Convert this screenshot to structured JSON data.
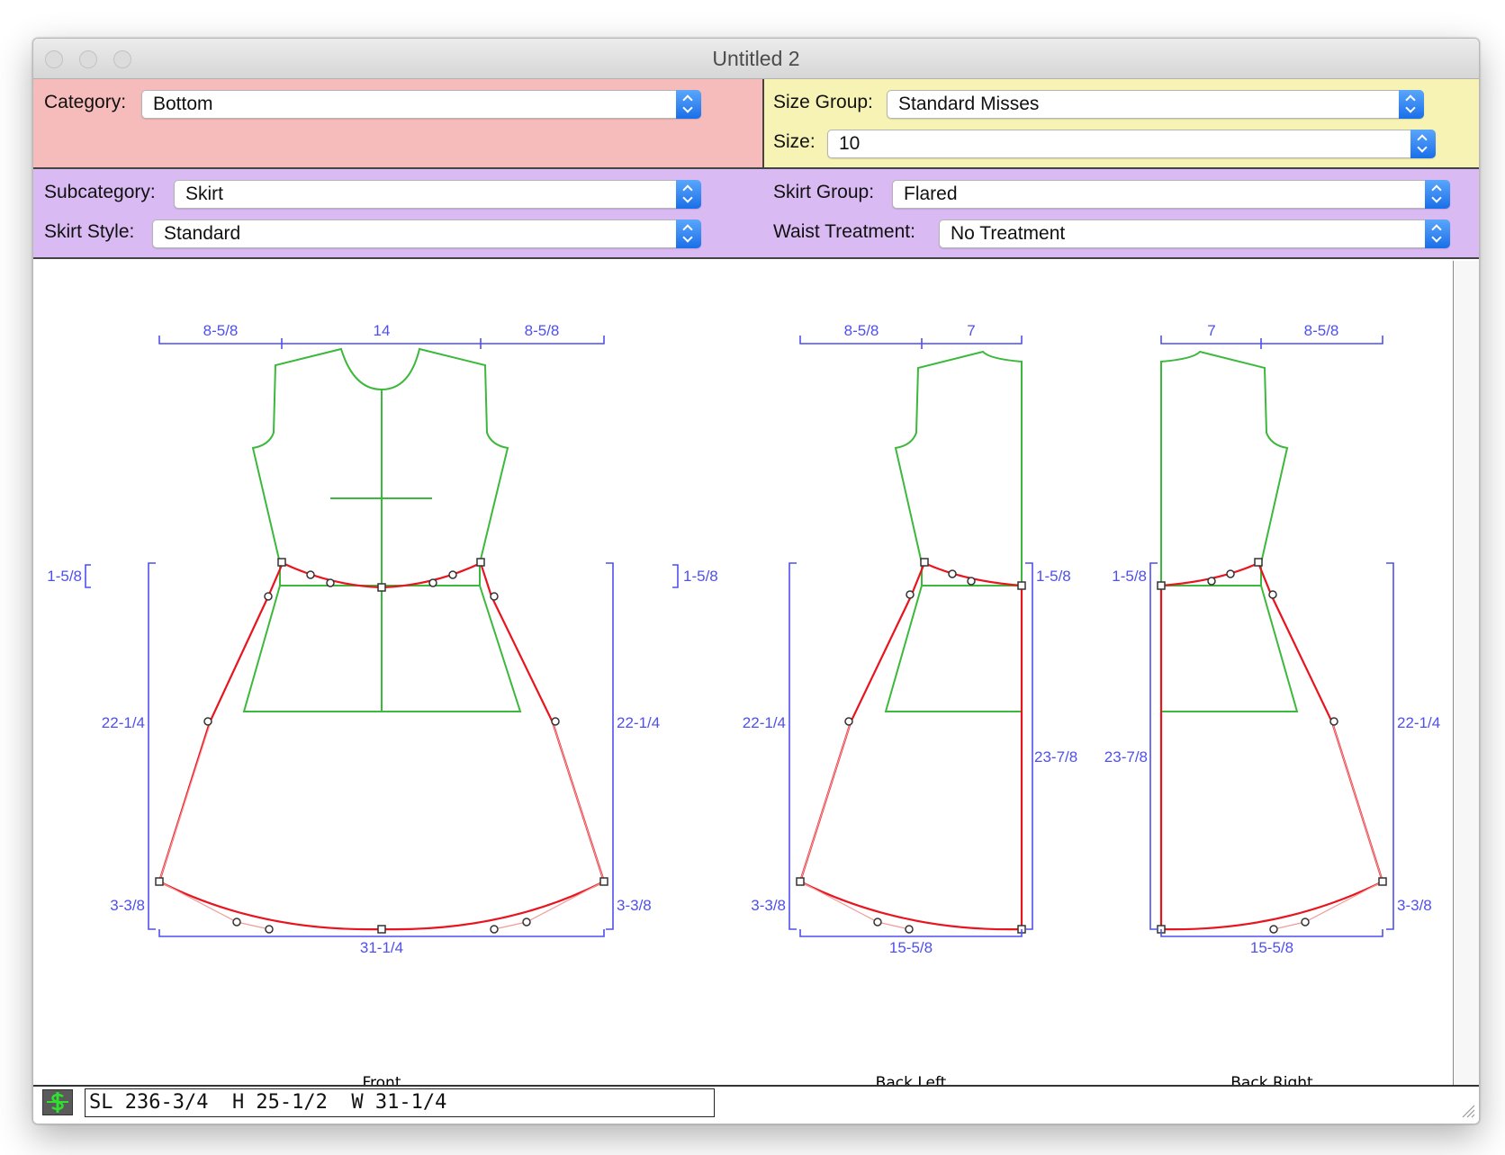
{
  "window": {
    "title": "Untitled 2"
  },
  "category": {
    "label": "Category:",
    "value": "Bottom"
  },
  "size_group": {
    "label": "Size Group:",
    "value": "Standard Misses"
  },
  "size": {
    "label": "Size:",
    "value": "10"
  },
  "subcategory": {
    "label": "Subcategory:",
    "value": "Skirt"
  },
  "skirt_group": {
    "label": "Skirt Group:",
    "value": "Flared"
  },
  "skirt_style": {
    "label": "Skirt Style:",
    "value": "Standard"
  },
  "waist_treatment": {
    "label": "Waist Treatment:",
    "value": "No Treatment"
  },
  "front": {
    "caption": "Front",
    "top_left": "8-5/8",
    "top_center": "14",
    "top_right": "8-5/8",
    "waist_left": "1-5/8",
    "waist_right": "1-5/8",
    "side_left": "22-1/4",
    "side_right": "22-1/4",
    "hem_left": "3-3/8",
    "hem_right": "3-3/8",
    "bottom": "31-1/4"
  },
  "back_left": {
    "caption": "Back Left",
    "top_left": "8-5/8",
    "top_right": "7",
    "waist_right": "1-5/8",
    "side_left": "22-1/4",
    "center": "23-7/8",
    "hem_left": "3-3/8",
    "bottom": "15-5/8"
  },
  "back_right": {
    "caption": "Back Right",
    "top_left": "7",
    "top_right": "8-5/8",
    "waist_left": "1-5/8",
    "center": "23-7/8",
    "side_right": "22-1/4",
    "hem_right": "3-3/8",
    "bottom": "15-5/8"
  },
  "status": {
    "text": "SL 236-3/4  H 25-1/2  W 31-1/4"
  },
  "colors": {
    "bodice": "#3cb83c",
    "skirt": "#e8141e",
    "dimension": "#4f4fee",
    "category_band": "#f6bcbc",
    "size_band": "#f6f3b5",
    "style_band": "#d9baf3",
    "popup_arrow": "#1a6fe9"
  },
  "icons": {
    "status_icon": "dollar-icon"
  }
}
